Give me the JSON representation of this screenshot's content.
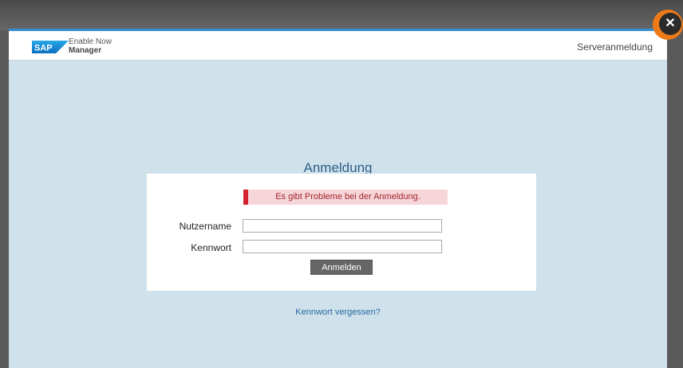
{
  "header": {
    "logo_text": "SAP",
    "app_name_line1": "Enable Now",
    "app_name_line2": "Manager",
    "server_link": "Serveranmeldung"
  },
  "login": {
    "title": "Anmeldung",
    "error_message": "Es gibt Probleme bei der Anmeldung.",
    "username_label": "Nutzername",
    "username_value": "",
    "password_label": "Kennwort",
    "password_value": "",
    "submit_label": "Anmelden",
    "forgot_link": "Kennwort vergessen?"
  },
  "close_button": {
    "icon": "close-icon",
    "glyph": "✕"
  },
  "colors": {
    "accent": "#3a8ecf",
    "page_bg": "#cfe2eb",
    "error_bar": "#d2222e",
    "error_bg": "#f6d6d9",
    "button_bg": "#666666",
    "close_ring": "#ee7a17"
  }
}
